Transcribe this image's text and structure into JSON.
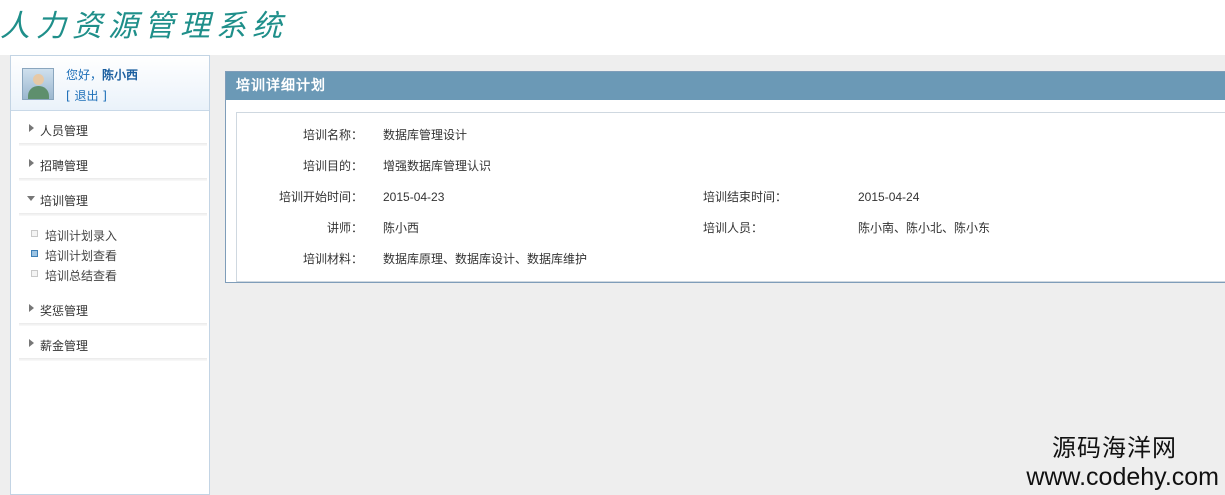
{
  "app": {
    "title": "人力资源管理系统"
  },
  "user": {
    "greeting": "您好，",
    "name": "陈小西",
    "logout": "[ 退出 ]"
  },
  "sidebar": {
    "items": [
      {
        "label": "人员管理",
        "expanded": false
      },
      {
        "label": "招聘管理",
        "expanded": false
      },
      {
        "label": "培训管理",
        "expanded": true,
        "children": [
          {
            "label": "培训计划录入",
            "active": false
          },
          {
            "label": "培训计划查看",
            "active": true
          },
          {
            "label": "培训总结查看",
            "active": false
          }
        ]
      },
      {
        "label": "奖惩管理",
        "expanded": false
      },
      {
        "label": "薪金管理",
        "expanded": false
      }
    ]
  },
  "panel": {
    "title": "培训详细计划"
  },
  "detail": {
    "name_label": "培训名称：",
    "name_value": "数据库管理设计",
    "goal_label": "培训目的：",
    "goal_value": "增强数据库管理认识",
    "start_label": "培训开始时间：",
    "start_value": "2015-04-23",
    "end_label": "培训结束时间：",
    "end_value": "2015-04-24",
    "teacher_label": "讲师：",
    "teacher_value": "陈小西",
    "staff_label": "培训人员：",
    "staff_value": "陈小南、陈小北、陈小东",
    "material_label": "培训材料：",
    "material_value": "数据库原理、数据库设计、数据库维护"
  },
  "watermark": {
    "line1": "源码海洋网",
    "line2": "www.codehy.com"
  },
  "colors": {
    "panel_header": "#6b99b6",
    "link_blue": "#1d6fb8",
    "logo_teal": "#1f8f8a",
    "workarea": "#eeeeee"
  }
}
